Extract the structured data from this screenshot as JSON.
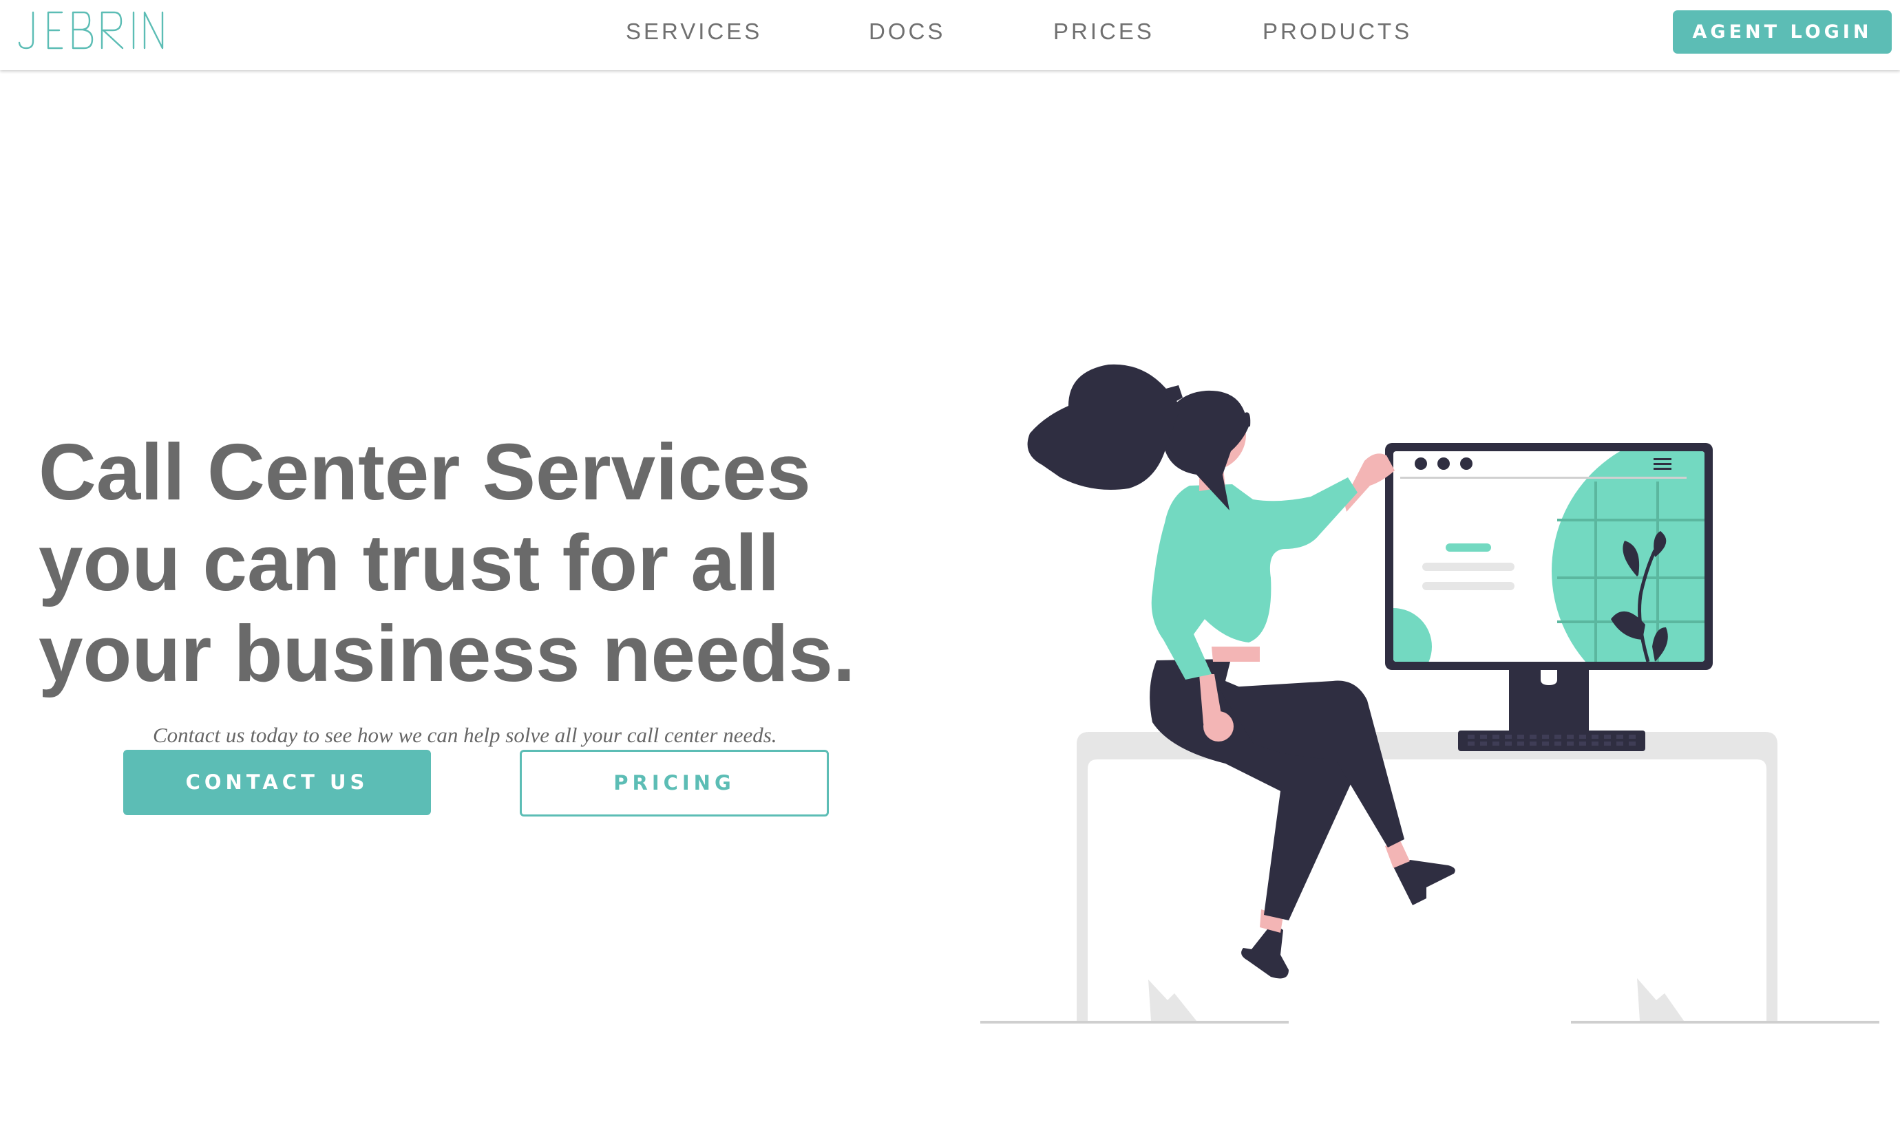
{
  "header": {
    "logo_text": "JEBRIN",
    "nav": [
      {
        "label": "SERVICES"
      },
      {
        "label": "DOCS"
      },
      {
        "label": "PRICES"
      },
      {
        "label": "PRODUCTS"
      }
    ],
    "agent_login_label": "AGENT LOGIN"
  },
  "hero": {
    "title_lines": [
      "Call Center Services",
      "you can trust for all",
      "your business needs."
    ],
    "subtitle": "Contact us today to see how we can help solve all your call center needs.",
    "contact_label": "CONTACT US",
    "pricing_label": "PRICING"
  },
  "illustration": {
    "icon": "woman-at-desk-computer-illustration"
  },
  "colors": {
    "accent": "#5cbdb5",
    "accent_light": "#73d9c1",
    "text_gray": "#6a6a6a",
    "nav_gray": "#707070",
    "dark": "#2f2e41",
    "skin": "#f3b5b5",
    "desk_gray": "#e6e6e6"
  }
}
